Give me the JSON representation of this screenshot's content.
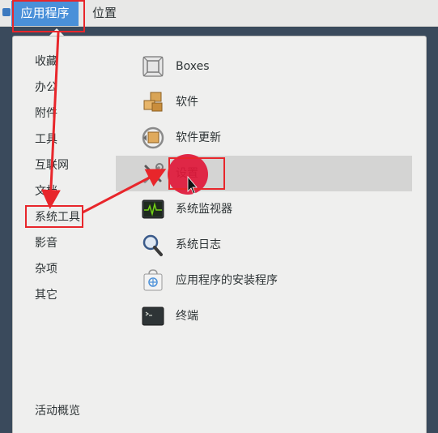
{
  "topbar": {
    "applications_label": "应用程序",
    "places_label": "位置"
  },
  "sidebar": {
    "categories": [
      {
        "label": "收藏"
      },
      {
        "label": "办公"
      },
      {
        "label": "附件"
      },
      {
        "label": "工具"
      },
      {
        "label": "互联网"
      },
      {
        "label": "文档"
      },
      {
        "label": "系统工具"
      },
      {
        "label": "影音"
      },
      {
        "label": "杂项"
      },
      {
        "label": "其它"
      }
    ],
    "activities_overview": "活动概览"
  },
  "apps": [
    {
      "label": "Boxes",
      "icon": "boxes-icon"
    },
    {
      "label": "软件",
      "icon": "software-icon"
    },
    {
      "label": "软件更新",
      "icon": "software-update-icon"
    },
    {
      "label": "设置",
      "icon": "settings-icon",
      "selected": true
    },
    {
      "label": "系统监视器",
      "icon": "system-monitor-icon"
    },
    {
      "label": "系统日志",
      "icon": "system-log-icon"
    },
    {
      "label": "应用程序的安装程序",
      "icon": "app-installer-icon"
    },
    {
      "label": "终端",
      "icon": "terminal-icon"
    }
  ],
  "colors": {
    "accent": "#4a90d9",
    "annotation_red": "#e8262b",
    "panel_bg": "#efefee",
    "selected_row": "#d4d4d3"
  }
}
